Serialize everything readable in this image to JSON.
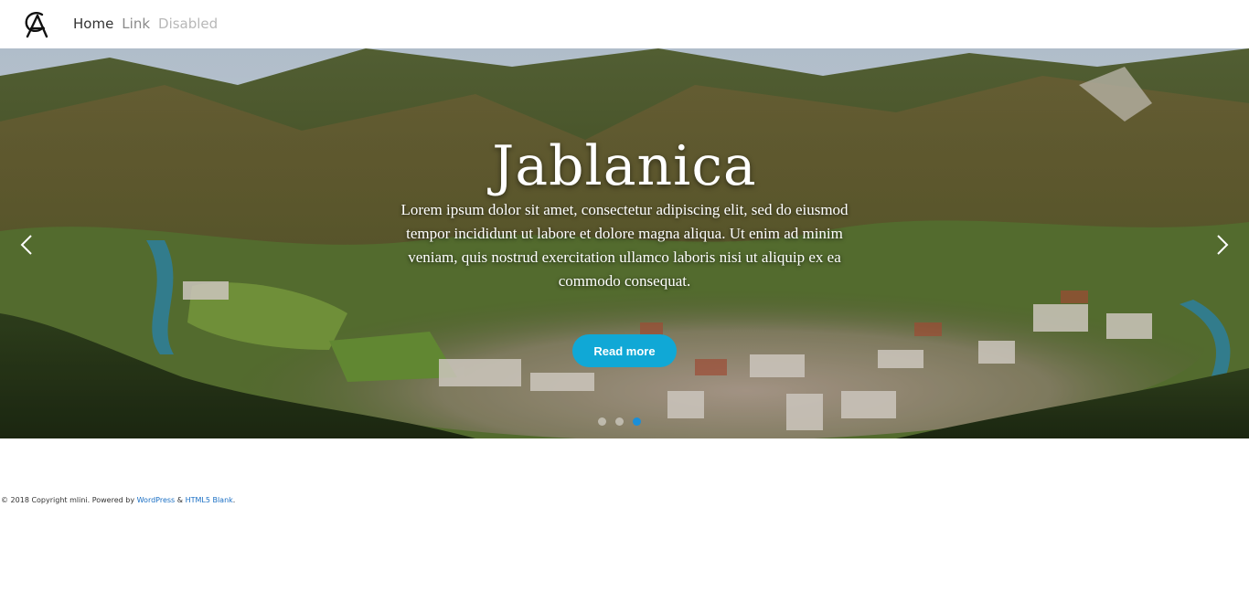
{
  "nav": {
    "logo": "A-logo",
    "links": [
      {
        "label": "Home"
      },
      {
        "label": "Link"
      },
      {
        "label": "Disabled"
      }
    ]
  },
  "hero": {
    "title": "Jablanica",
    "text": "Lorem ipsum dolor sit amet, consectetur adipiscing elit, sed do eiusmod tempor incididunt ut labore et dolore magna aliqua. Ut enim ad minim veniam, quis nostrud exercitation ullamco laboris nisi ut aliquip ex ea commodo consequat.",
    "button_label": "Read more",
    "prev_icon": "chevron-left-icon",
    "next_icon": "chevron-right-icon",
    "slides_count": 3,
    "active_slide": 3,
    "colors": {
      "button": "#10a8d6",
      "active_dot": "#1a8fd8"
    }
  },
  "footer": {
    "prefix": "© 2018 Copyright mlini. Powered by ",
    "link1": "WordPress",
    "middle": " & ",
    "link2": "HTML5 Blank",
    "suffix": ".",
    "link_color": "#1a6fc4"
  }
}
